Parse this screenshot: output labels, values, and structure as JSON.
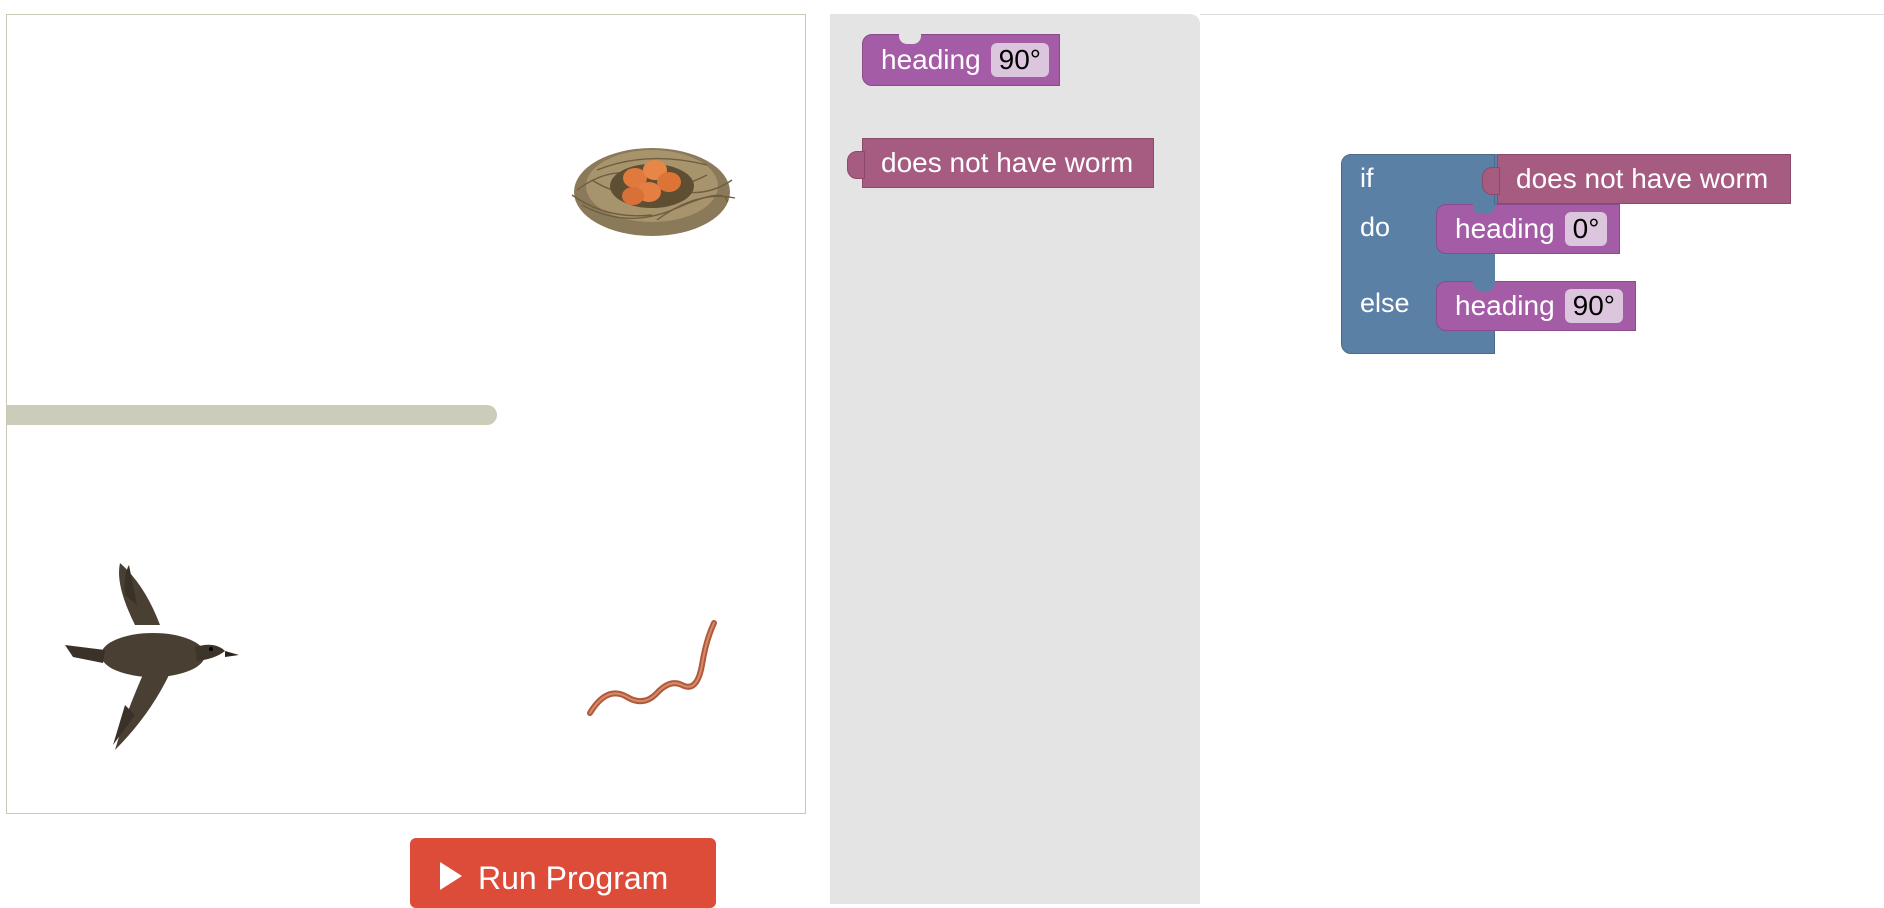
{
  "game": {
    "sprites": {
      "nest": "nest-with-eggs",
      "bird": "flying-bird",
      "worm": "earthworm"
    },
    "colors": {
      "wall": "#ccccbb",
      "border": "#c9c9b6"
    }
  },
  "run_button": {
    "label": "Run Program",
    "color": "#dd4b39"
  },
  "toolbox": {
    "blocks": [
      {
        "type": "heading",
        "label": "heading",
        "value": "90°"
      },
      {
        "type": "condition",
        "label": "does not have worm"
      }
    ]
  },
  "workspace": {
    "if_block": {
      "keyword_if": "if",
      "keyword_do": "do",
      "keyword_else": "else",
      "condition": "does not have worm",
      "do_block": {
        "label": "heading",
        "value": "0°"
      },
      "else_block": {
        "label": "heading",
        "value": "90°"
      }
    }
  },
  "colors": {
    "motion": "#a55ca6",
    "sensing": "#a65b80",
    "logic": "#5b80a5",
    "toolbox_bg": "#e4e4e4"
  }
}
